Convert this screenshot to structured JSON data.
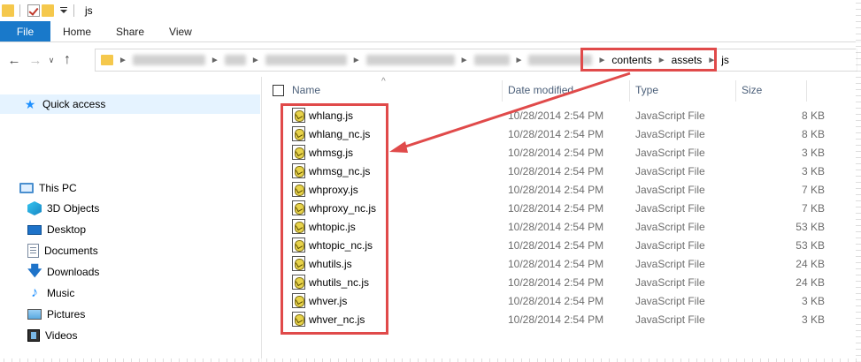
{
  "window": {
    "title": "js"
  },
  "ribbon": {
    "tabs": [
      "File",
      "Home",
      "Share",
      "View"
    ]
  },
  "address": {
    "crumbs": [
      "contents",
      "assets",
      "js"
    ],
    "recent_icon": "chevron-down-icon"
  },
  "nav": {
    "quick_access": "Quick access",
    "items": [
      {
        "label": "This PC",
        "icon": "computer-icon"
      },
      {
        "label": "3D Objects",
        "icon": "cube-icon"
      },
      {
        "label": "Desktop",
        "icon": "desktop-icon"
      },
      {
        "label": "Documents",
        "icon": "documents-icon"
      },
      {
        "label": "Downloads",
        "icon": "download-icon"
      },
      {
        "label": "Music",
        "icon": "music-icon"
      },
      {
        "label": "Pictures",
        "icon": "pictures-icon"
      },
      {
        "label": "Videos",
        "icon": "videos-icon"
      }
    ]
  },
  "columns": {
    "name": "Name",
    "date": "Date modified",
    "type": "Type",
    "size": "Size"
  },
  "files": [
    {
      "name": "whlang.js",
      "date": "10/28/2014 2:54 PM",
      "type": "JavaScript File",
      "size": "8 KB"
    },
    {
      "name": "whlang_nc.js",
      "date": "10/28/2014 2:54 PM",
      "type": "JavaScript File",
      "size": "8 KB"
    },
    {
      "name": "whmsg.js",
      "date": "10/28/2014 2:54 PM",
      "type": "JavaScript File",
      "size": "3 KB"
    },
    {
      "name": "whmsg_nc.js",
      "date": "10/28/2014 2:54 PM",
      "type": "JavaScript File",
      "size": "3 KB"
    },
    {
      "name": "whproxy.js",
      "date": "10/28/2014 2:54 PM",
      "type": "JavaScript File",
      "size": "7 KB"
    },
    {
      "name": "whproxy_nc.js",
      "date": "10/28/2014 2:54 PM",
      "type": "JavaScript File",
      "size": "7 KB"
    },
    {
      "name": "whtopic.js",
      "date": "10/28/2014 2:54 PM",
      "type": "JavaScript File",
      "size": "53 KB"
    },
    {
      "name": "whtopic_nc.js",
      "date": "10/28/2014 2:54 PM",
      "type": "JavaScript File",
      "size": "53 KB"
    },
    {
      "name": "whutils.js",
      "date": "10/28/2014 2:54 PM",
      "type": "JavaScript File",
      "size": "24 KB"
    },
    {
      "name": "whutils_nc.js",
      "date": "10/28/2014 2:54 PM",
      "type": "JavaScript File",
      "size": "24 KB"
    },
    {
      "name": "whver.js",
      "date": "10/28/2014 2:54 PM",
      "type": "JavaScript File",
      "size": "3 KB"
    },
    {
      "name": "whver_nc.js",
      "date": "10/28/2014 2:54 PM",
      "type": "JavaScript File",
      "size": "3 KB"
    }
  ],
  "colors": {
    "accent": "#1979ca",
    "highlight": "#e04a4a",
    "selection": "#e5f3ff"
  }
}
